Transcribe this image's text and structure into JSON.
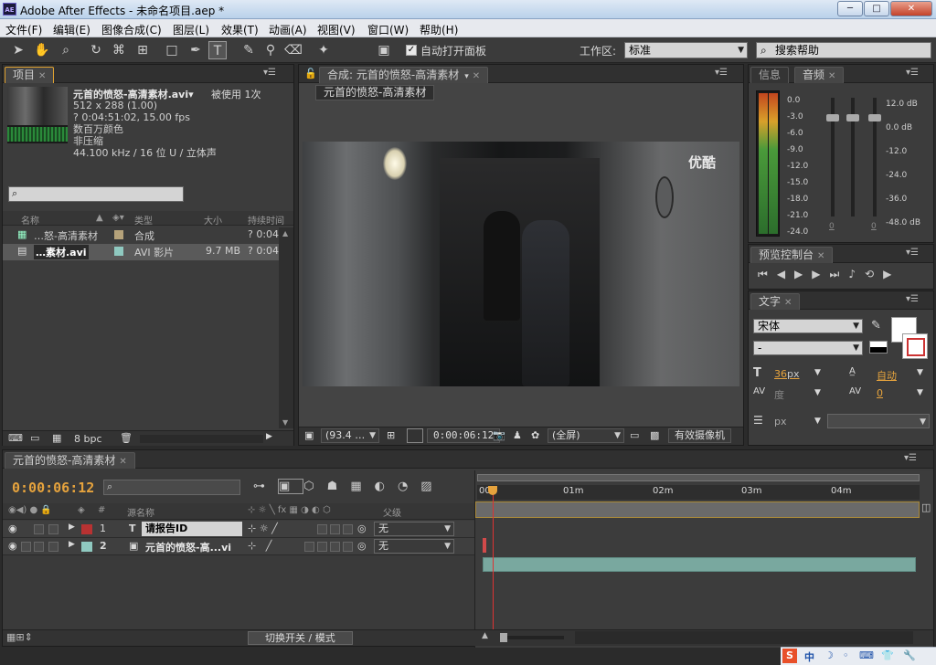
{
  "window": {
    "app_icon_text": "AE",
    "title": "Adobe After Effects - 未命名项目.aep *",
    "controls": {
      "minimize": "─",
      "maximize": "□",
      "close": "✕"
    }
  },
  "menubar": [
    "文件(F)",
    "编辑(E)",
    "图像合成(C)",
    "图层(L)",
    "效果(T)",
    "动画(A)",
    "视图(V)",
    "窗口(W)",
    "帮助(H)"
  ],
  "toolbar": {
    "auto_open_label": "自动打开面板",
    "workspace_label": "工作区:",
    "workspace_value": "标准",
    "search_help": "搜索帮助"
  },
  "project_panel": {
    "tab": "项目",
    "item_name": "元首的愤怒-高清素材.avi▾",
    "used_count": "被使用 1次",
    "info_lines": [
      "512 x 288 (1.00)",
      "? 0:04:51:02, 15.00 fps",
      "数百万颜色",
      "非压缩",
      "44.100 kHz / 16 位 U / 立体声"
    ],
    "columns": {
      "name": "名称",
      "type": "类型",
      "size": "大小",
      "duration": "持续时间"
    },
    "items": [
      {
        "name": "…怒-高清素材",
        "type": "合成",
        "size": "",
        "duration": "? 0:04",
        "label_color": "#b5a27a"
      },
      {
        "name": "…素材.avi",
        "type": "AVI 影片",
        "size": "9.7 MB",
        "duration": "? 0:04",
        "label_color": "#8fc9c0"
      }
    ],
    "bpc": "8 bpc"
  },
  "comp_panel": {
    "tab": "合成: 元首的愤怒-高清素材",
    "breadcrumb": "元首的愤怒-高清素材",
    "zoom": "(93.4 …",
    "timecode": "0:00:06:12",
    "resolution": "(全屏)",
    "camera": "有效摄像机",
    "video_watermark": "优酷"
  },
  "info_tabs": {
    "info": "信息",
    "audio": "音频"
  },
  "audio": {
    "left_scale": [
      "0.0",
      "-3.0",
      "-6.0",
      "-9.0",
      "-12.0",
      "-15.0",
      "-18.0",
      "-21.0",
      "-24.0"
    ],
    "right_scale": [
      "12.0 dB",
      "0.0 dB",
      "-12.0",
      "-24.0",
      "-36.0",
      "-48.0 dB"
    ],
    "slider_values": [
      "0",
      "0"
    ]
  },
  "preview_panel": {
    "tab": "预览控制台"
  },
  "char_panel": {
    "tab": "文字",
    "font": "宋体",
    "style": "-",
    "size": "36",
    "size_unit": "px",
    "leading": "自动",
    "kerning_label": "度",
    "tracking": "0",
    "stroke_unit": "px"
  },
  "timeline": {
    "tab": "元首的愤怒-高清素材",
    "timecode": "0:00:06:12",
    "col_source": "源名称",
    "col_parent": "父级",
    "ruler": [
      "00s",
      "01m",
      "02m",
      "03m",
      "04m"
    ],
    "layers": [
      {
        "num": "1",
        "type_icon": "T",
        "name": "请报告ID",
        "parent": "无",
        "label_color": "#b83232"
      },
      {
        "num": "2",
        "type_icon": "▣",
        "name": "元首的愤怒-高...vi",
        "parent": "无",
        "label_color": "#8fc9c0"
      }
    ],
    "toggle_label": "切换开关 / 模式"
  },
  "taskbar": [
    "S",
    "中",
    "☽",
    "◦",
    "⌨",
    "👕",
    "🔧"
  ]
}
